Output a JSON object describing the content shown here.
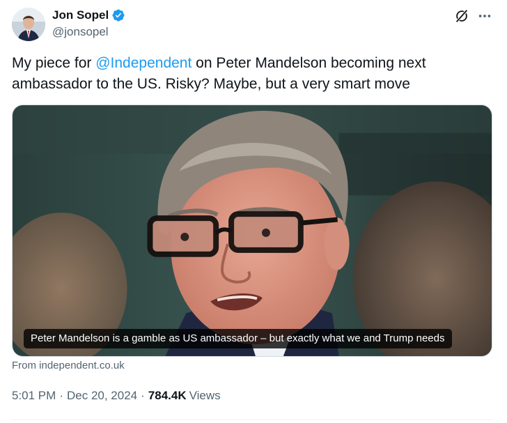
{
  "author": {
    "display_name": "Jon Sopel",
    "handle": "@jonsopel",
    "verified": true,
    "verified_color": "#1d9bf0"
  },
  "tweet": {
    "text_before": "My piece for ",
    "mention": "@Independent",
    "text_after": " on Peter Mandelson becoming next ambassador to the US. Risky? Maybe, but a very smart move",
    "mention_color": "#1d9bf0"
  },
  "link_card": {
    "caption": "Peter Mandelson is a gamble as US ambassador – but exactly what we and Trump needs",
    "source": "From independent.co.uk"
  },
  "meta": {
    "time": "5:01 PM",
    "date": "Dec 20, 2024",
    "views_count": "784.4K",
    "views_label": "Views"
  },
  "icons": {
    "grok": "grok-icon",
    "more": "more-options-icon",
    "verified": "verified-badge-icon"
  }
}
